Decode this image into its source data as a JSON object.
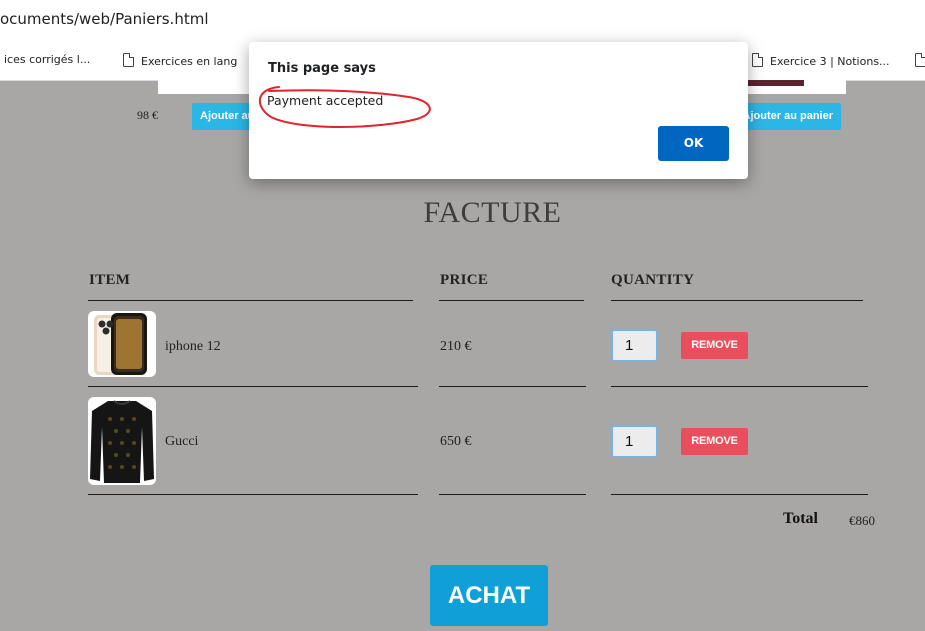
{
  "browser": {
    "url_fragment": "ocuments/web/Paniers.html",
    "bookmarks": [
      "ices corrigés l...",
      "Exercices en lang",
      "Exercice 3 | Notions..."
    ]
  },
  "shop": {
    "product_price": "98 €",
    "add_to_cart_left": "Ajouter au panier",
    "add_to_cart_right": "Ajouter au panier"
  },
  "invoice": {
    "title": "FACTURE",
    "columns": {
      "item": "ITEM",
      "price": "PRICE",
      "quantity": "QUANTITY"
    },
    "rows": [
      {
        "name": "iphone 12",
        "price": "210 €",
        "quantity": "1",
        "remove_label": "REMOVE"
      },
      {
        "name": "Gucci",
        "price": "650 €",
        "quantity": "1",
        "remove_label": "REMOVE"
      }
    ],
    "total_label": "Total",
    "total_value": "€860",
    "buy_label": "ACHAT"
  },
  "dialog": {
    "title": "This page says",
    "message": "Payment accepted",
    "ok_label": "OK"
  },
  "colors": {
    "page_bg": "#a8a7a5",
    "cart_button": "#2bb6e6",
    "remove_button": "#ea4e5c",
    "buy_button": "#0fa0d8",
    "dialog_ok": "#0067c0",
    "scribble": "#e0242a"
  }
}
